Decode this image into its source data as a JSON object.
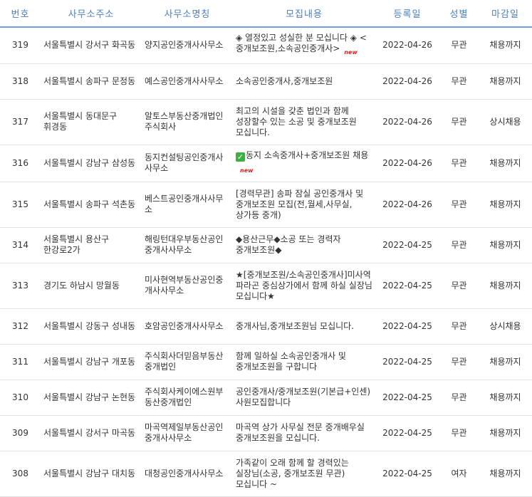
{
  "table": {
    "headers": [
      "번호",
      "사무소주소",
      "사무소명칭",
      "모집내용",
      "등록일",
      "성별",
      "마감일"
    ],
    "rows": [
      {
        "no": "319",
        "address": "서울특별시 강서구 화곡동",
        "name": "양지공인중개사사무소",
        "content": "◈ 열정있고 성실한 분 모십니다 ◈ <중개보조원,소속공인중개사>",
        "is_new": true,
        "new_label": "new",
        "has_check": false,
        "date": "2022-04-26",
        "gender": "무관",
        "deadline": "채용까지",
        "height": 51
      },
      {
        "no": "318",
        "address": "서울특별시 송파구 문정동",
        "name": "예스공인중개사사무소",
        "content": "소속공인중개사,중개보조원",
        "is_new": false,
        "new_label": "",
        "has_check": false,
        "date": "2022-04-26",
        "gender": "무관",
        "deadline": "채용까지",
        "height": 50
      },
      {
        "no": "317",
        "address": "서울특별시 동대문구 휘경동",
        "name": "알토스부동산중개법인주식회사",
        "content": "최고의 시설을 갖춘 법인과 함께 성장할수 있는 소공 및 중개보조원 모십니다.",
        "is_new": false,
        "new_label": "",
        "has_check": false,
        "date": "2022-04-26",
        "gender": "무관",
        "deadline": "상시채용",
        "height": 64
      },
      {
        "no": "316",
        "address": "서울특별시 강남구 삼성동",
        "name": "동지컨설팅공인중개사사무소",
        "content": "동지 소속중개사+중개보조원 채용",
        "is_new": true,
        "new_label": "new",
        "has_check": true,
        "check_icon": "check-mark-icon",
        "date": "2022-04-26",
        "gender": "무관",
        "deadline": "채용까지",
        "height": 52
      },
      {
        "no": "315",
        "address": "서울특별시 송파구 석촌동",
        "name": "베스트공인중개사사무소",
        "content": "[경력무관] 송파 잠실 공인중개사 및 중개보조원 모집(전,월세,사무실,상가등 중개)",
        "is_new": false,
        "new_label": "",
        "has_check": false,
        "date": "2022-04-26",
        "gender": "무관",
        "deadline": "채용까지",
        "height": 64
      },
      {
        "no": "314",
        "address": "서울특별시 용산구 한강로2가",
        "name": "해링턴대우부동산공인중개사사무소",
        "content": "◆용산근무◆소공 또는 경력자 중개보조원◆",
        "is_new": false,
        "new_label": "",
        "has_check": false,
        "date": "2022-04-25",
        "gender": "무관",
        "deadline": "채용까지",
        "height": 50
      },
      {
        "no": "313",
        "address": "경기도 하남시 망월동",
        "name": "미사현역부동산공인중개사사무소",
        "content": "★[중개보조원/소속공인중개사]미사역 파라곤 중심상가에서 함께 하실 실장님 모십니다★",
        "is_new": false,
        "new_label": "",
        "has_check": false,
        "date": "2022-04-25",
        "gender": "무관",
        "deadline": "채용까지",
        "height": 64
      },
      {
        "no": "312",
        "address": "서울특별시 강동구 성내동",
        "name": "호암공인중개사사무소",
        "content": "중개사님,중개보조원님 모십니다.",
        "is_new": false,
        "new_label": "",
        "has_check": false,
        "date": "2022-04-25",
        "gender": "무관",
        "deadline": "상시채용",
        "height": 50
      },
      {
        "no": "311",
        "address": "서울특별시 강남구 개포동",
        "name": "주식회사더믿음부동산중개법인",
        "content": "함께 일하실 소속공인중개사 및 중개보조원을 구합니다",
        "is_new": false,
        "new_label": "",
        "has_check": false,
        "date": "2022-04-25",
        "gender": "무관",
        "deadline": "채용까지",
        "height": 50
      },
      {
        "no": "310",
        "address": "서울특별시 강남구 논현동",
        "name": "주식회사케이에스원부동산중개법인",
        "content": "공인중개사/중개보조원(기본급+인센)사원모집합니다",
        "is_new": false,
        "new_label": "",
        "has_check": false,
        "date": "2022-04-25",
        "gender": "무관",
        "deadline": "채용까지",
        "height": 50
      },
      {
        "no": "309",
        "address": "서울특별시 강서구 마곡동",
        "name": "마곡역제일부동산공인중개사사무소",
        "content": "마곡역 상가 사무실 전문 중개배우실 중개보조원을 모십니다.",
        "is_new": false,
        "new_label": "",
        "has_check": false,
        "date": "2022-04-25",
        "gender": "무관",
        "deadline": "채용까지",
        "height": 50
      },
      {
        "no": "308",
        "address": "서울특별시 강남구 대치동",
        "name": "대청공인중개사사무소",
        "content": "가족같이 오래 함께 할 경력있는 실장님(소공, 중개보조원 무관) 모십니다 ~",
        "is_new": false,
        "new_label": "",
        "has_check": false,
        "date": "2022-04-25",
        "gender": "여자",
        "deadline": "채용까지",
        "height": 64
      }
    ]
  }
}
